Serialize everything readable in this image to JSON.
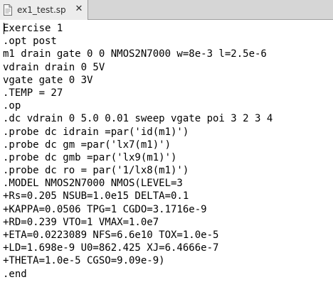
{
  "tab": {
    "title": "ex1_test.sp",
    "close_glyph": "✕",
    "icon": "document-icon"
  },
  "editor": {
    "lines": [
      "Exercise 1",
      ".opt post",
      "m1 drain gate 0 0 NMOS2N7000 w=8e-3 l=2.5e-6",
      "vdrain drain 0 5V",
      "vgate gate 0 3V",
      ".TEMP = 27",
      ".op",
      ".dc vdrain 0 5.0 0.01 sweep vgate poi 3 2 3 4",
      ".probe dc idrain =par('id(m1)')",
      ".probe dc gm =par('lx7(m1)')",
      ".probe dc gmb =par('lx9(m1)')",
      ".probe dc ro = par('1/lx8(m1)')",
      ".MODEL NMOS2N7000 NMOS(LEVEL=3",
      "+Rs=0.205 NSUB=1.0e15 DELTA=0.1",
      "+KAPPA=0.0506 TPG=1 CGDO=3.1716e-9",
      "+RD=0.239 VTO=1 VMAX=1.0e7",
      "+ETA=0.0223089 NFS=6.6e10 TOX=1.0e-5",
      "+LD=1.698e-9 U0=862.425 XJ=6.4666e-7",
      "+THETA=1.0e-5 CGSO=9.09e-9)",
      ".end"
    ]
  }
}
